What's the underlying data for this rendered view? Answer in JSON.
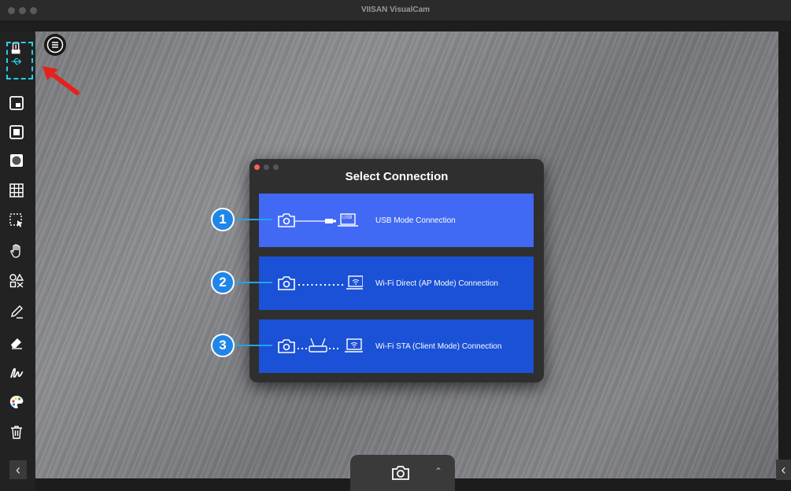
{
  "window": {
    "title": "VIISAN VisualCam"
  },
  "dialog": {
    "title": "Select Connection",
    "options": [
      {
        "number": "1",
        "label": "USB Mode Connection",
        "device_text": "USB",
        "color": "#4169f4"
      },
      {
        "number": "2",
        "label": "Wi-Fi Direct (AP Mode) Connection",
        "color": "#1a51d6"
      },
      {
        "number": "3",
        "label": "Wi-Fi STA (Client Mode) Connection",
        "color": "#1a51d6"
      }
    ]
  },
  "sidebar": {
    "tools": [
      "usb-connection-icon",
      "pip-icon",
      "stop-icon",
      "vignette-icon",
      "grid-icon",
      "select-area-icon",
      "hand-icon",
      "shapes-icon",
      "pen-icon",
      "eraser-icon",
      "signature-icon",
      "palette-icon",
      "trash-icon"
    ]
  },
  "colors": {
    "highlight": "#22d0e6",
    "annotation_arrow": "#e6201c",
    "badge": "#1f86e8"
  }
}
